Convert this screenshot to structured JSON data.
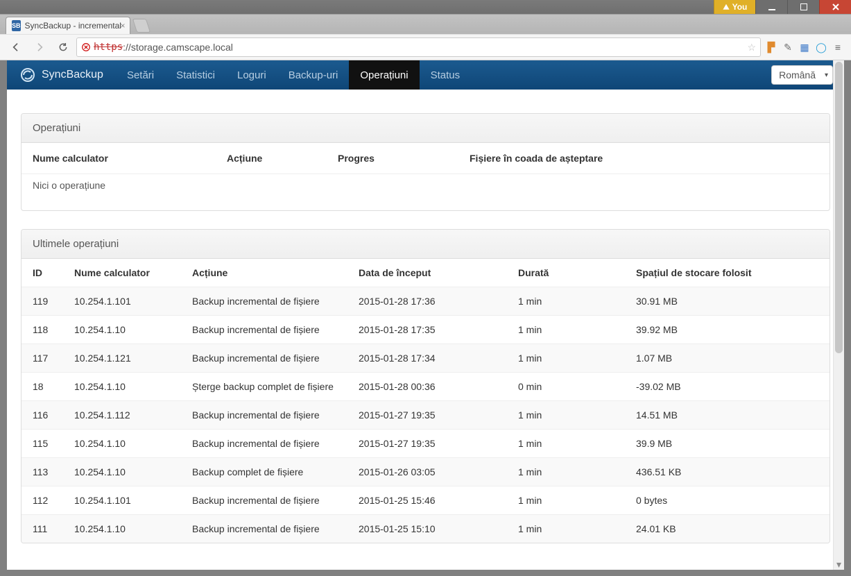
{
  "window": {
    "user_badge": "You"
  },
  "browser": {
    "tab_title": "SyncBackup - incremental",
    "address_prefix": "https",
    "address": "://storage.camscape.local"
  },
  "app": {
    "brand": "SyncBackup",
    "nav": [
      {
        "label": "Setări",
        "active": false
      },
      {
        "label": "Statistici",
        "active": false
      },
      {
        "label": "Loguri",
        "active": false
      },
      {
        "label": "Backup-uri",
        "active": false
      },
      {
        "label": "Operațiuni",
        "active": true
      },
      {
        "label": "Status",
        "active": false
      }
    ],
    "language": "Română"
  },
  "operations": {
    "title": "Operațiuni",
    "headers": {
      "computer": "Nume calculator",
      "action": "Acțiune",
      "progress": "Progres",
      "queue": "Fișiere în coada de așteptare"
    },
    "empty_text": "Nici o operațiune"
  },
  "history": {
    "title": "Ultimele operațiuni",
    "headers": {
      "id": "ID",
      "computer": "Nume calculator",
      "action": "Acțiune",
      "start": "Data de început",
      "duration": "Durată",
      "storage": "Spațiul de stocare folosit"
    },
    "rows": [
      {
        "id": "119",
        "computer": "10.254.1.101",
        "action": "Backup incremental de fișiere",
        "start": "2015-01-28 17:36",
        "duration": "1 min",
        "storage": "30.91 MB"
      },
      {
        "id": "118",
        "computer": "10.254.1.10",
        "action": "Backup incremental de fișiere",
        "start": "2015-01-28 17:35",
        "duration": "1 min",
        "storage": "39.92 MB"
      },
      {
        "id": "117",
        "computer": "10.254.1.121",
        "action": "Backup incremental de fișiere",
        "start": "2015-01-28 17:34",
        "duration": "1 min",
        "storage": "1.07 MB"
      },
      {
        "id": "18",
        "computer": "10.254.1.10",
        "action": "Șterge backup complet de fișiere",
        "start": "2015-01-28 00:36",
        "duration": "0 min",
        "storage": "-39.02 MB"
      },
      {
        "id": "116",
        "computer": "10.254.1.112",
        "action": "Backup incremental de fișiere",
        "start": "2015-01-27 19:35",
        "duration": "1 min",
        "storage": "14.51 MB"
      },
      {
        "id": "115",
        "computer": "10.254.1.10",
        "action": "Backup incremental de fișiere",
        "start": "2015-01-27 19:35",
        "duration": "1 min",
        "storage": "39.9 MB"
      },
      {
        "id": "113",
        "computer": "10.254.1.10",
        "action": "Backup complet de fișiere",
        "start": "2015-01-26 03:05",
        "duration": "1 min",
        "storage": "436.51 KB"
      },
      {
        "id": "112",
        "computer": "10.254.1.101",
        "action": "Backup incremental de fișiere",
        "start": "2015-01-25 15:46",
        "duration": "1 min",
        "storage": "0 bytes"
      },
      {
        "id": "111",
        "computer": "10.254.1.10",
        "action": "Backup incremental de fișiere",
        "start": "2015-01-25 15:10",
        "duration": "1 min",
        "storage": "24.01 KB"
      }
    ]
  }
}
